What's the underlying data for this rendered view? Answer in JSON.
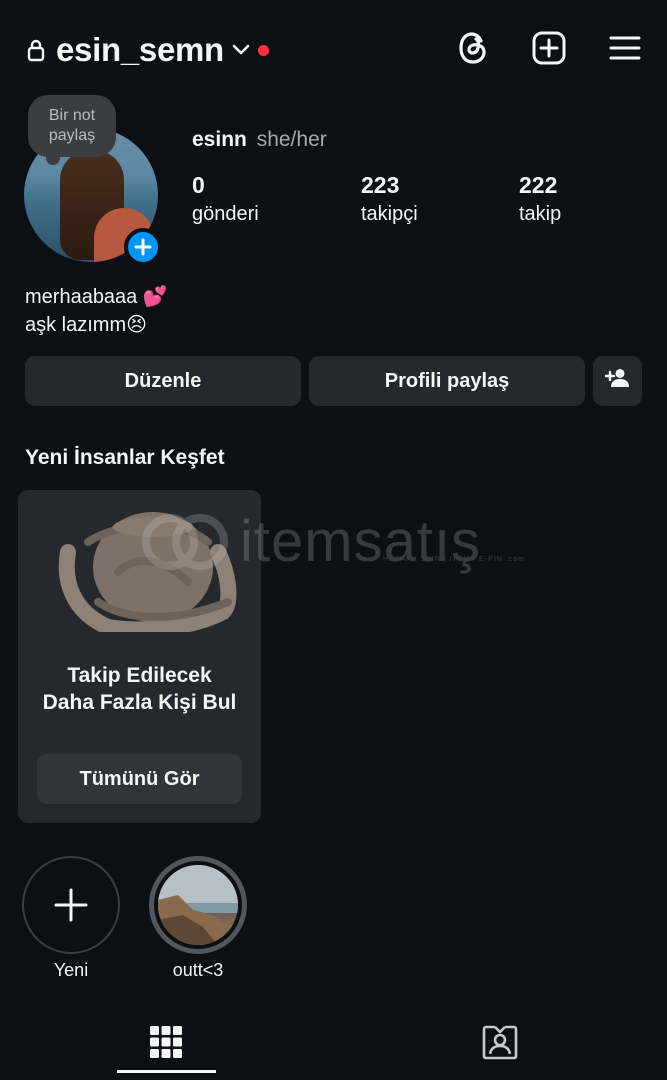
{
  "header": {
    "username": "esin_semn",
    "icons": [
      "lock-icon",
      "chevron-down-icon",
      "threads-icon",
      "add-post-icon",
      "menu-icon"
    ],
    "notification_dot_color": "#ff3040"
  },
  "profile": {
    "note": "Bir not paylaş",
    "display_name": "esinn",
    "pronouns": "she/her",
    "stats": [
      {
        "value": "0",
        "label": "gönderi"
      },
      {
        "value": "223",
        "label": "takipçi"
      },
      {
        "value": "222",
        "label": "takip"
      }
    ],
    "bio_line1": "merhaabaaa 💕",
    "bio_line2": "aşk lazımm😣"
  },
  "actions": {
    "edit": "Düzenle",
    "share": "Profili paylaş"
  },
  "discover": {
    "title": "Yeni İnsanlar Keşfet",
    "card_text_line1": "Takip Edilecek",
    "card_text_line2": "Daha Fazla Kişi Bul",
    "see_all": "Tümünü Gör"
  },
  "watermark": {
    "brand": "itemsatış",
    "tagline": "HESAP / SKIN / ITEM / E-PIN .com"
  },
  "highlights": [
    {
      "label": "Yeni"
    },
    {
      "label": "outt<3"
    }
  ],
  "colors": {
    "background": "#0c1014",
    "button_bg": "#25292e",
    "accent_blue": "#0095f6"
  }
}
